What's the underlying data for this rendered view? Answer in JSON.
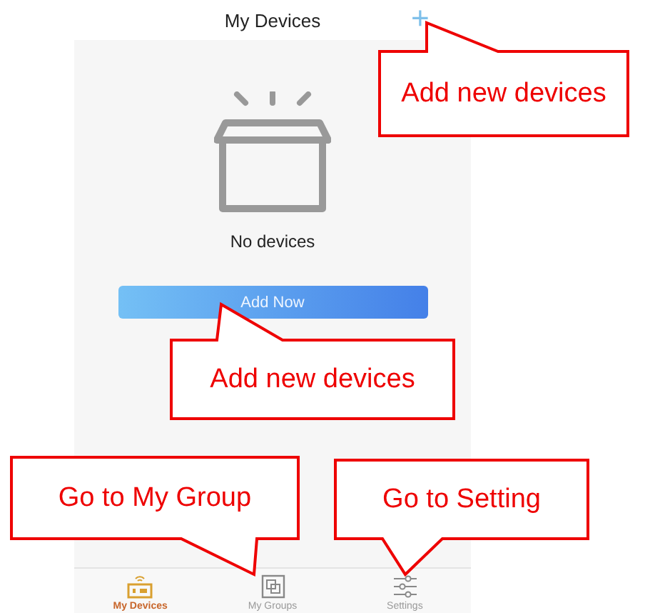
{
  "header": {
    "title": "My Devices",
    "add_icon": "+"
  },
  "empty_state": {
    "message": "No devices",
    "button": "Add Now"
  },
  "tab_bar": [
    {
      "label": "My Devices",
      "selected": true
    },
    {
      "label": "My Groups",
      "selected": false
    },
    {
      "label": "Settings",
      "selected": false
    }
  ],
  "callouts": [
    {
      "text": "Add new devices"
    },
    {
      "text": "Add new devices"
    },
    {
      "text": "Go to My Group"
    },
    {
      "text": "Go to Setting"
    }
  ]
}
